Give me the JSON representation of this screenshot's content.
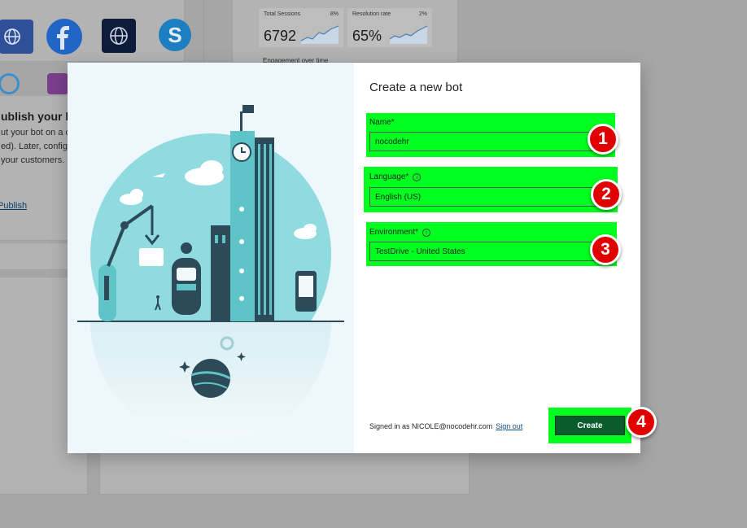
{
  "background": {
    "publish_card": {
      "title": "ublish your bo",
      "line1": "ut your bot on a c",
      "line2": "ed). Later, configu",
      "line3": "your customers.",
      "link": " Publish"
    },
    "metrics": [
      {
        "label": "Total Sessions",
        "value": "6792",
        "change": "8%"
      },
      {
        "label": "Resolution rate",
        "value": "65%",
        "change": "2%"
      }
    ],
    "engagement_label": "Engagement over time",
    "channel_icons": [
      "web-globe-icon",
      "facebook-icon",
      "website-icon",
      "skype-icon"
    ]
  },
  "modal": {
    "title": "Create a new bot",
    "name": {
      "label": "Name*",
      "value": "nocodehr"
    },
    "language": {
      "label": "Language*",
      "value": "English (US)"
    },
    "environment": {
      "label": "Environment*",
      "value": "TestDrive - United States"
    },
    "signed_in_text": "Signed in as NICOLE@nocodehr.com",
    "sign_out_label": "Sign out",
    "create_label": "Create"
  },
  "annotations": {
    "step1": "1",
    "step2": "2",
    "step3": "3",
    "step4": "4"
  },
  "colors": {
    "highlight": "#00ff1e",
    "badge": "#e00000",
    "create_button": "#0b5c2d",
    "overlay": "#a6a6a6"
  }
}
